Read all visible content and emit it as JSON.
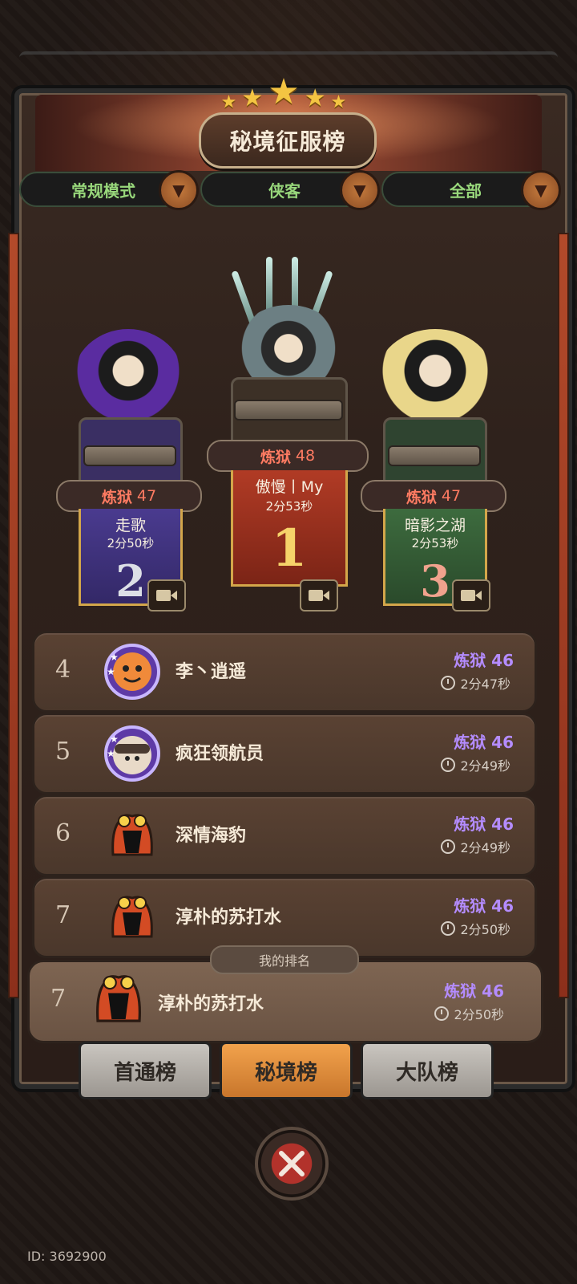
{
  "header": {
    "title": "秘境征服榜",
    "stars": 5
  },
  "filters": [
    {
      "label": "常规模式"
    },
    {
      "label": "侠客"
    },
    {
      "label": "全部"
    }
  ],
  "podium": {
    "first": {
      "rank": "1",
      "tier": "炼狱",
      "level": "48",
      "name": "傲慢丨My",
      "time": "2分53秒"
    },
    "second": {
      "rank": "2",
      "tier": "炼狱",
      "level": "47",
      "name": "走歌",
      "time": "2分50秒"
    },
    "third": {
      "rank": "3",
      "tier": "炼狱",
      "level": "47",
      "name": "暗影之湖",
      "time": "2分53秒"
    }
  },
  "list": [
    {
      "rank": "4",
      "name": "李丶逍遥",
      "tier": "炼狱 46",
      "time": "2分47秒",
      "icon": "tiger-avatar-icon"
    },
    {
      "rank": "5",
      "name": "疯狂领航员",
      "tier": "炼狱 46",
      "time": "2分49秒",
      "icon": "pilot-avatar-icon"
    },
    {
      "rank": "6",
      "name": "深情海豹",
      "tier": "炼狱 46",
      "time": "2分49秒",
      "icon": "flame-monster-avatar-icon"
    },
    {
      "rank": "7",
      "name": "淳朴的苏打水",
      "tier": "炼狱 46",
      "time": "2分50秒",
      "icon": "flame-monster-avatar-icon"
    }
  ],
  "my_rank": {
    "tag": "我的排名",
    "rank": "7",
    "name": "淳朴的苏打水",
    "tier": "炼狱 46",
    "time": "2分50秒"
  },
  "tabs": [
    {
      "label": "首通榜",
      "active": false
    },
    {
      "label": "秘境榜",
      "active": true
    },
    {
      "label": "大队榜",
      "active": false
    }
  ],
  "footer": {
    "id": "ID: 3692900"
  },
  "colors": {
    "tier_red": "#ff7b62",
    "tier_purple": "#b48cff",
    "filter_green": "#98d77b",
    "active_tab": "#f2a24c"
  }
}
